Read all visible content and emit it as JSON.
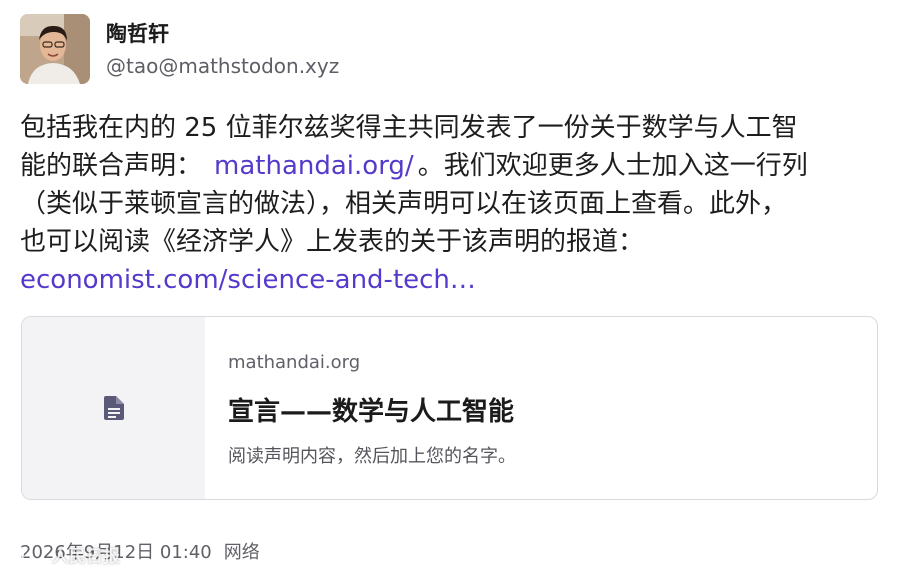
{
  "author": {
    "display_name": "陶哲轩",
    "handle": "@tao@mathstodon.xyz",
    "avatar_icon": "avatar-photo"
  },
  "post": {
    "text_1": "包括我在内的 25 位菲尔兹奖得主共同发表了一份关于数学与人工智",
    "text_2": "能的联合声明：",
    "link_1": "mathandai.org/",
    "text_3": "。我们欢迎更多人士加入这一行列",
    "text_4": "（类似于莱顿宣言的做法），相关声明可以在该页面上查看。此外，",
    "text_5": "也可以阅读《经济学人》上发表的关于该声明的报道：",
    "link_2": "economist.com/science-and-tech…",
    "link_color": "#563acc"
  },
  "card": {
    "icon": "document-icon",
    "host": "mathandai.org",
    "title": "宣言——数学与人工智能",
    "description": "阅读声明内容，然后加上您的名字。"
  },
  "meta": {
    "timestamp": "2026年9月12日 01:40",
    "visibility": "网络"
  },
  "watermark": {
    "text": "人民日报"
  }
}
